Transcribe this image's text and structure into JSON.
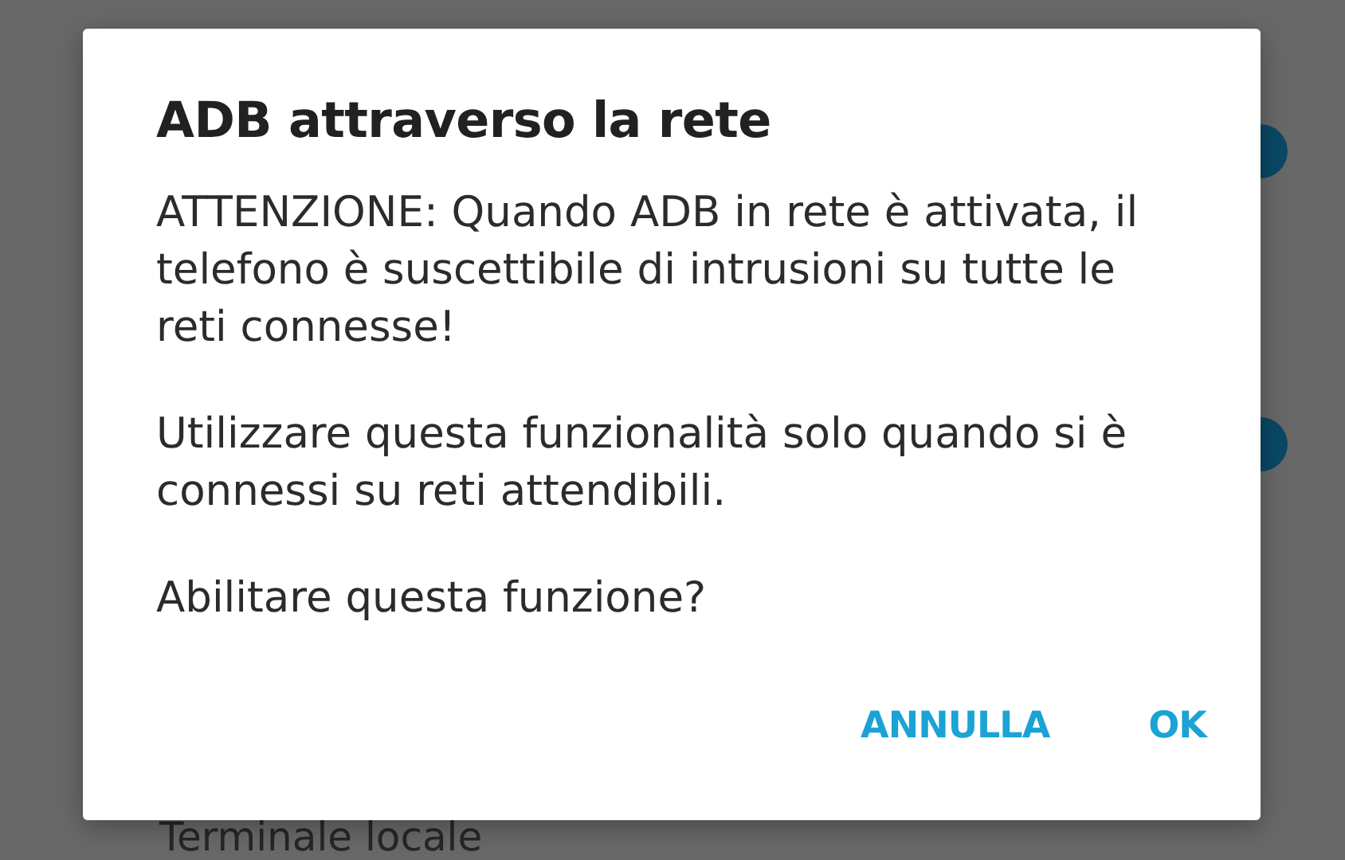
{
  "background": {
    "switches": [
      {
        "on": true
      },
      {
        "on": true
      }
    ],
    "item_label": "Terminale locale"
  },
  "dialog": {
    "title": "ADB attraverso la rete",
    "paragraphs": [
      "ATTENZIONE: Quando ADB in rete è attivata, il telefono è suscettibile di intrusioni su tutte le reti connesse!",
      "Utilizzare questa funzionalità solo quando si è connessi su reti attendibili.",
      "Abilitare questa funzione?"
    ],
    "buttons": [
      "ANNULLA",
      "OK"
    ]
  }
}
